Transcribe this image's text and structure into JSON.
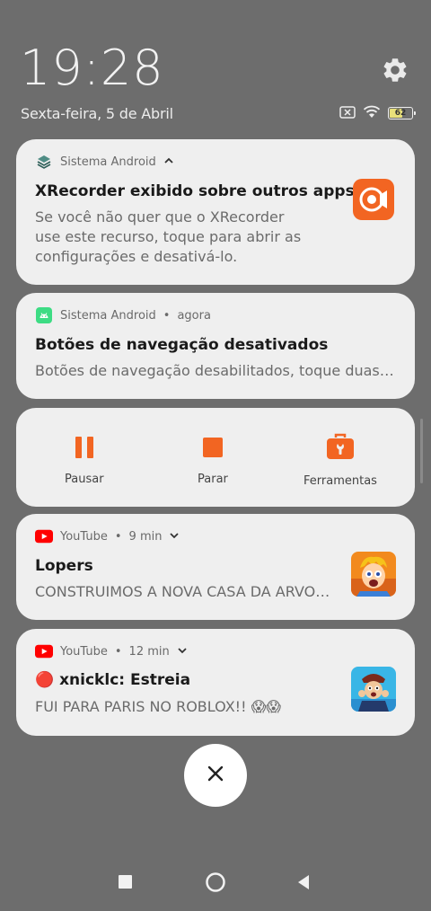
{
  "status": {
    "time": "19:28",
    "date": "Sexta-feira, 5 de Abril",
    "battery": "62",
    "battery_level": 0.62
  },
  "notifications": [
    {
      "app": "Sistema Android",
      "title": "XRecorder exibido sobre outros apps.",
      "text_lines": [
        "Se você não quer que o XRecorder",
        "use este recurso, toque para abrir as",
        "configurações e desativá-lo."
      ],
      "icon": "layers-icon",
      "thumb_icon": "xrecorder-app-icon"
    },
    {
      "app": "Sistema Android",
      "time": "agora",
      "title": "Botões de navegação desativados",
      "text": "Botões de navegação desabilitados, toque duas vezes",
      "icon": "android-icon"
    },
    {
      "app": "YouTube",
      "time": "9 min",
      "title": "Lopers",
      "text": "CONSTRUIMOS A NOVA CASA DA ARVORE",
      "icon": "youtube-icon"
    },
    {
      "app": "YouTube",
      "time": "12 min",
      "title": "🔴 xnicklc: Estreia",
      "text": "FUI PARA PARIS NO ROBLOX!! 😱😱",
      "icon": "youtube-icon"
    }
  ],
  "recorder_controls": {
    "pause": "Pausar",
    "stop": "Parar",
    "tools": "Ferramentas"
  },
  "separator": "•",
  "colors": {
    "accent_orange": "#f26522",
    "youtube_red": "#ff0000",
    "android_green": "#3ddc84",
    "background": "#6d6d6d",
    "card": "#efefef"
  }
}
